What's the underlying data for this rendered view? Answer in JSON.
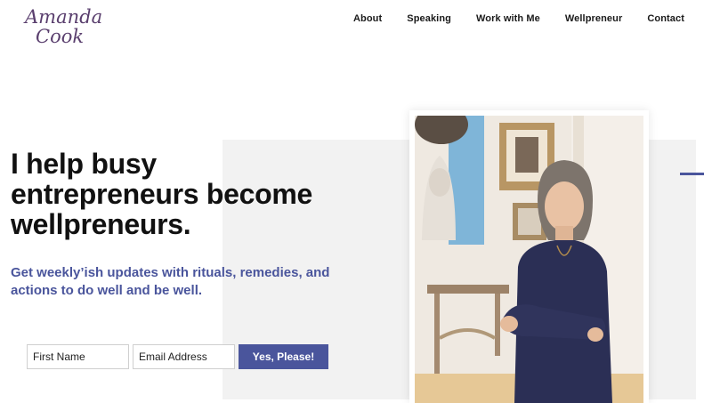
{
  "logo": {
    "line1": "Amanda",
    "line2": "Cook"
  },
  "nav": {
    "items": [
      "About",
      "Speaking",
      "Work with Me",
      "Wellpreneur",
      "Contact"
    ]
  },
  "hero": {
    "headline": "I help busy entrepreneurs become wellpreneurs.",
    "subhead": "Get weekly’ish updates with rituals, remedies, and actions to do well and be well."
  },
  "signup": {
    "first_name_placeholder": "First Name",
    "email_placeholder": "Email Address",
    "submit_label": "Yes, Please!"
  },
  "colors": {
    "accent": "#4a559c",
    "logo": "#5a3f6e",
    "panel": "#f2f2f2"
  }
}
